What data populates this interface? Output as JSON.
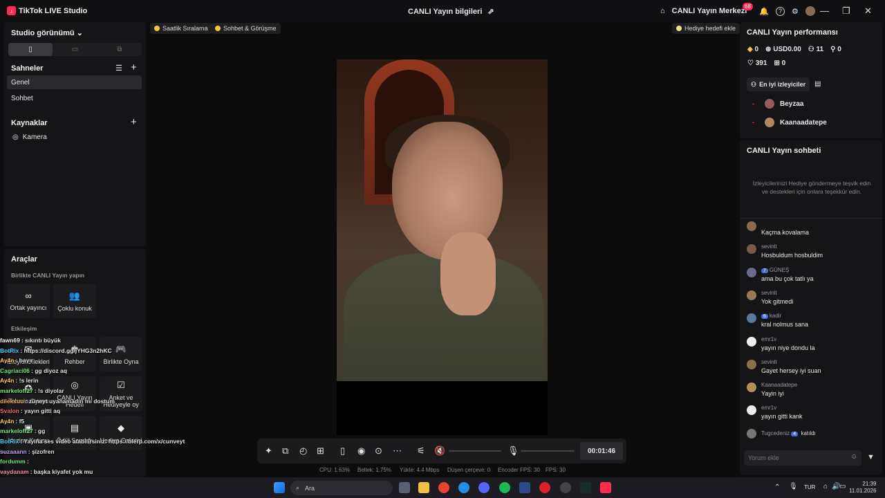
{
  "app": {
    "title": "TikTok LIVE Studio",
    "center_title": "CANLI Yayın bilgileri",
    "live_center": "CANLI Yayın Merkezi",
    "notif_count": "68",
    "logo_glyph": "♪",
    "edit_icon": "⇗",
    "home_icon": "⌂",
    "bell_icon": "🔔",
    "help_icon": "?",
    "settings_icon": "⚙",
    "min_icon": "—",
    "max_icon": "❐",
    "close_icon": "✕"
  },
  "left": {
    "studio_view": "Studio görünümü",
    "layout_icons": [
      "▯",
      "▭",
      "⧉"
    ],
    "scenes_label": "Sahneler",
    "scene_list_icon": "☰",
    "add_icon": "+",
    "scenes": [
      "Genel",
      "Sohbet"
    ],
    "sources_label": "Kaynaklar",
    "sources": [
      "Kamera"
    ],
    "camera_icon": "◎"
  },
  "tools": {
    "title": "Araçlar",
    "collab_label": "Birlikte CANLI Yayın yapın",
    "collab": [
      {
        "label": "Ortak yayıncı",
        "icon": "∞"
      },
      {
        "label": "Çoklu konuk",
        "icon": "👥"
      }
    ],
    "interaction_label": "Etkileşim",
    "interaction": [
      {
        "label": "İzleyici Dilekleri",
        "icon": "✉"
      },
      {
        "label": "Rehber",
        "icon": "♚"
      },
      {
        "label": "Birlikte Oyna",
        "icon": "🎮"
      },
      {
        "label": "Tahmin Oyunu",
        "icon": "✪"
      },
      {
        "label": "CANLI Yayın Hedefi",
        "icon": "◎"
      },
      {
        "label": "Anket ve Hediyeyle oy",
        "icon": "☑"
      },
      {
        "label": "Hazine Kutusu",
        "icon": "▣"
      },
      {
        "label": "Ödül Sandığı",
        "icon": "▤"
      },
      {
        "label": "Hediye Galerisi",
        "icon": "◆"
      }
    ]
  },
  "chat_overlay": [
    {
      "user": "fawn69",
      "text": ": sıkıntı büyük",
      "color": "#ffffff"
    },
    {
      "user": "BotRix",
      "text": ": https://discord.gg/jYHG3n2hKC",
      "color": "#4dd2ff"
    },
    {
      "user": "Ay4n",
      "text": ": bayır",
      "color": "#ffd25a"
    },
    {
      "user": "Cagriaci06",
      "text": ": gg diyoz aq",
      "color": "#6bf07a"
    },
    {
      "user": "Ay4n",
      "text": ": !s lerin",
      "color": "#ffd25a"
    },
    {
      "user": "markeloff27",
      "text": ": !s diyolar",
      "color": "#7df07d"
    },
    {
      "user": "dileksuu",
      "text": ": züneyt uyanamadın mı dostum",
      "color": "#ffb347"
    },
    {
      "user": "Svalon",
      "text": ": yayın gitti aq",
      "color": "#ff6b6b"
    },
    {
      "user": "Ay4n",
      "text": ": f5",
      "color": "#ffd25a"
    },
    {
      "user": "markeloff27",
      "text": ": gg",
      "color": "#7df07d"
    },
    {
      "user": "BotRix",
      "text": ": Yayına ses video atabilirsiniz: https://blerp.com/x/cunveyt",
      "color": "#4dd2ff"
    },
    {
      "user": "suzaaann",
      "text": ": şizofren",
      "color": "#c9a4ff"
    },
    {
      "user": "fordumm",
      "text": ":",
      "color": "#6bf07a"
    },
    {
      "user": "vaydanam",
      "text": ": başka kiyafet yok mu",
      "color": "#ff8fa3"
    },
    {
      "user": "sadadamgoz",
      "text": ": selam sağ daşşağımı önce soldan sonra sağa ağzımda geveledığım",
      "color": "#ffd25a"
    }
  ],
  "canvas": {
    "chip_ranking": "Saatlik Sıralama",
    "chip_chat": "Sohbet & Görüşme",
    "chip_gift_goal": "Hediye hedefi ekle"
  },
  "controls": {
    "icons": [
      "✦",
      "⧉",
      "◴",
      "⊞",
      "▯",
      "◉",
      "⊙",
      "⋯",
      "⚟",
      "🔇",
      "🎙"
    ],
    "timer": "00:01:46"
  },
  "stats": {
    "cpu": "CPU: 1.63%",
    "memory": "Bellek: 1.75%",
    "upload": "Yükle: 4.4 Mbps",
    "dropped": "Düşen çerçeve: 0",
    "encoder_fps": "Encoder FPS: 30",
    "fps": "FPS: 30"
  },
  "perf": {
    "title": "CANLI Yayın performansı",
    "diamonds": "0",
    "usd": "USD0.00",
    "viewers": "11",
    "new_followers": "0",
    "likes": "391",
    "gifts": "0",
    "top_viewers_tab": "En iyi izleyiciler",
    "top_viewers": [
      "Beyzaa",
      "Kaanaadatepe"
    ]
  },
  "live_chat": {
    "title": "CANLI Yayın sohbeti",
    "hint": "İzleyicilerinizi Hediye göndermeye teşvik edin ve destekleri için onlara teşekkür edin.",
    "messages": [
      {
        "name": "",
        "text": "Kaçma kovalama"
      },
      {
        "name": "sevinlt",
        "text": "Hosbuldum hosbuldim"
      },
      {
        "name": "GÜNEŞ",
        "level": "7",
        "text": "ama bu çok tatlı ya"
      },
      {
        "name": "sevinlt",
        "text": "Yok gitmedi"
      },
      {
        "name": "kadir",
        "level": "6",
        "text": "kral nolmus sana"
      },
      {
        "name": "emr1v",
        "text": "yayın niye dondu la"
      },
      {
        "name": "sevinlt",
        "text": "Gayet hersey iyi suan"
      },
      {
        "name": "Kaanaadatepe",
        "text": "Yayin iyi"
      },
      {
        "name": "emr1v",
        "text": "yayın gitti kank"
      }
    ],
    "join_user": "Tugcedeniz",
    "join_level": "4",
    "join_text": "katıldı",
    "comment_placeholder": "Yorum ekle"
  },
  "taskbar": {
    "search": "Ara",
    "lang": "TUR",
    "time": "21:39",
    "date": "11.01.2026",
    "search_icon": "⌕",
    "up_arrow_icon": "⌃",
    "mic_icon": "🎙",
    "network_icon": "⌂",
    "volume_icon": "🔊",
    "battery_icon": "▭"
  }
}
